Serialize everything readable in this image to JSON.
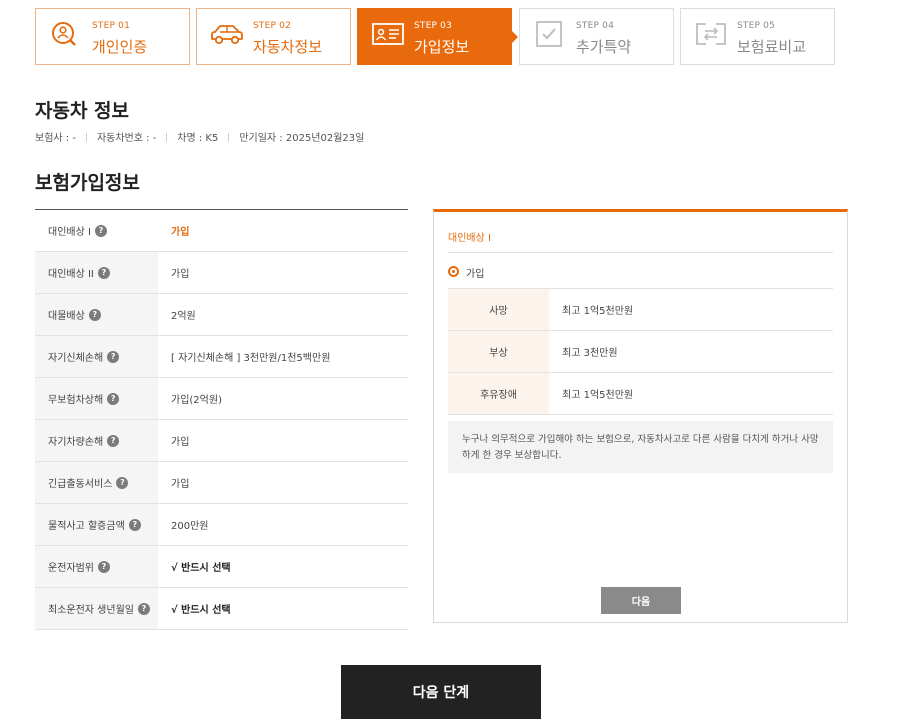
{
  "steps": [
    {
      "num": "STEP 01",
      "label": "개인인증",
      "icon": "person-search-icon",
      "state": "done"
    },
    {
      "num": "STEP 02",
      "label": "자동차정보",
      "icon": "car-icon",
      "state": "done"
    },
    {
      "num": "STEP 03",
      "label": "가입정보",
      "icon": "id-card-icon",
      "state": "active"
    },
    {
      "num": "STEP 04",
      "label": "추가특약",
      "icon": "checkbox-icon",
      "state": "todo"
    },
    {
      "num": "STEP 05",
      "label": "보험료비교",
      "icon": "compare-icon",
      "state": "todo"
    }
  ],
  "car": {
    "title": "자동차 정보",
    "insurer": "보험사 : -",
    "car_number": "자동차번호 : -",
    "car_name": "차명 : K5",
    "start_date": "만기일자 : 2025년02월23일"
  },
  "insurance": {
    "title": "보험가입정보",
    "rows": [
      {
        "label": "대인배상 I",
        "value": "가입",
        "style": "active"
      },
      {
        "label": "대인배상 II",
        "value": "가입",
        "style": ""
      },
      {
        "label": "대물배상",
        "value": "2억원",
        "style": ""
      },
      {
        "label": "자기신체손해",
        "value": "[ 자기신체손해 ] 3천만원/1천5백만원",
        "style": ""
      },
      {
        "label": "무보험차상해",
        "value": "가입(2억원)",
        "style": ""
      },
      {
        "label": "자기차량손해",
        "value": "가입",
        "style": ""
      },
      {
        "label": "긴급출동서비스",
        "value": "가입",
        "style": ""
      },
      {
        "label": "물적사고 할증금액",
        "value": "200만원",
        "style": ""
      },
      {
        "label": "운전자범위",
        "value": "√ 반드시 선택",
        "style": "strong"
      },
      {
        "label": "최소운전자 생년월일",
        "value": "√ 반드시 선택",
        "style": "strong"
      }
    ]
  },
  "panel": {
    "title": "대인배상 I",
    "option_label": "가입",
    "rows": [
      {
        "label": "사망",
        "value": "최고 1억5천만원"
      },
      {
        "label": "부상",
        "value": "최고 3천만원"
      },
      {
        "label": "후유장애",
        "value": "최고 1억5천만원"
      }
    ],
    "description": "누구나 의무적으로 가입해야 하는 보험으로, 자동차사고로 다른 사람을 다치게 하거나 사망하게 한 경우 보상합니다.",
    "button_label": "다음"
  },
  "next_button_label": "다음 단계",
  "colors": {
    "accent": "#e96a0c",
    "dark_button": "#222222",
    "gray_button": "#8a8a8a"
  }
}
